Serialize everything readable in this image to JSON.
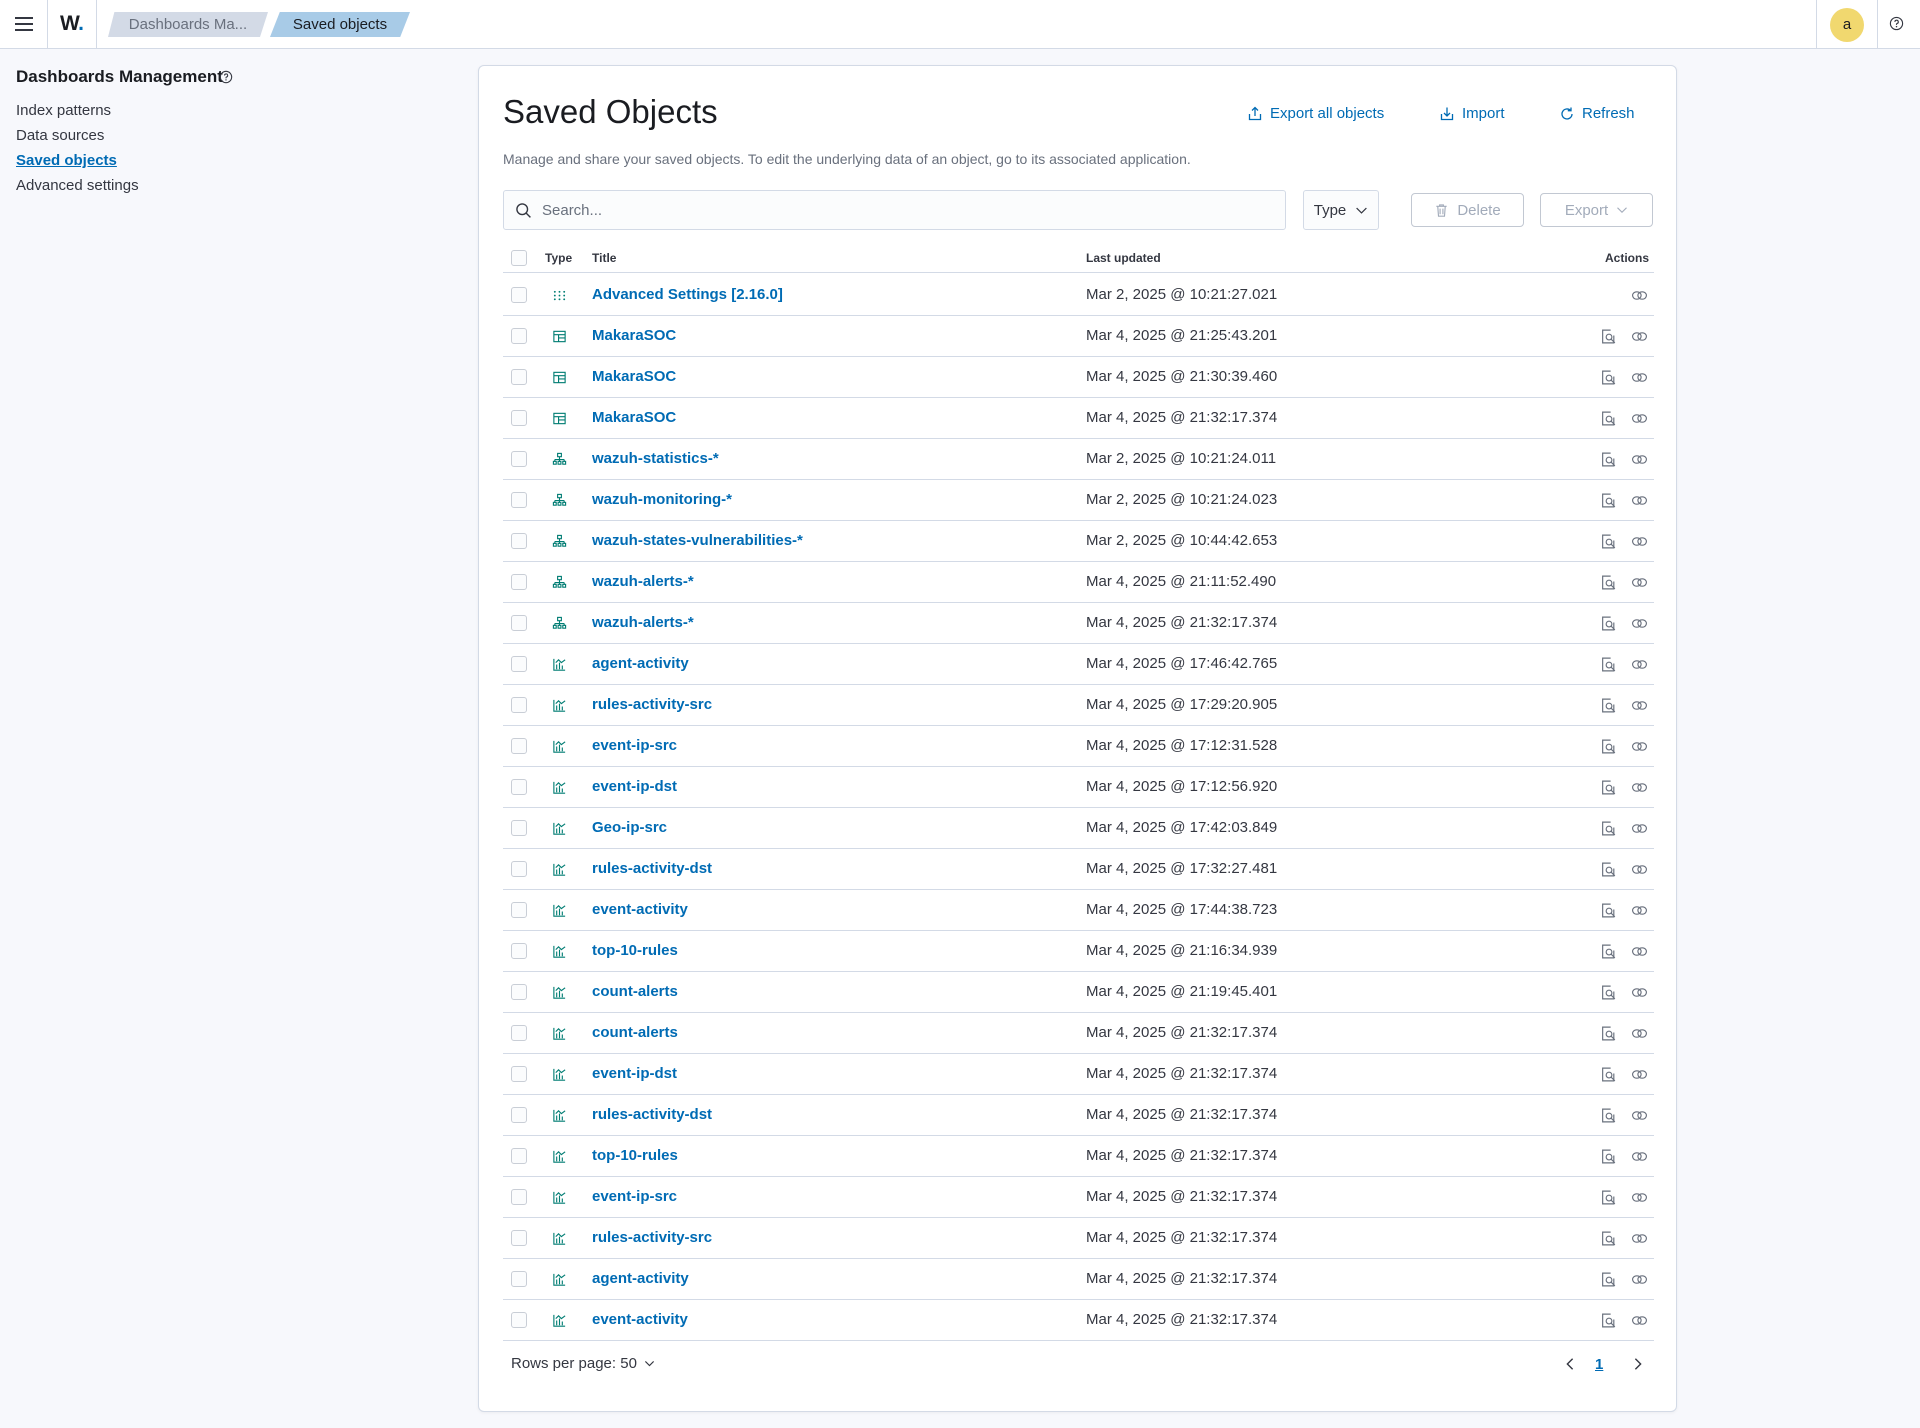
{
  "header": {
    "logo": "W",
    "logo_dot": ".",
    "breadcrumbs": [
      {
        "label": "Dashboards Ma..."
      },
      {
        "label": "Saved objects"
      }
    ],
    "avatar_initial": "a"
  },
  "sidebar": {
    "title": "Dashboards Management",
    "items": [
      {
        "label": "Index patterns",
        "active": false
      },
      {
        "label": "Data sources",
        "active": false
      },
      {
        "label": "Saved objects",
        "active": true
      },
      {
        "label": "Advanced settings",
        "active": false
      }
    ]
  },
  "main": {
    "title": "Saved Objects",
    "export_all_label": "Export all objects",
    "import_label": "Import",
    "refresh_label": "Refresh",
    "description": "Manage and share your saved objects. To edit the underlying data of an object, go to its associated application.",
    "search_placeholder": "Search...",
    "type_filter_label": "Type",
    "delete_label": "Delete",
    "export_label": "Export"
  },
  "table": {
    "columns": {
      "type": "Type",
      "title": "Title",
      "updated": "Last updated",
      "actions": "Actions"
    },
    "rows": [
      {
        "type": "config",
        "title": "Advanced Settings [2.16.0]",
        "updated": "Mar 2, 2025 @ 10:21:27.021",
        "inspect": false
      },
      {
        "type": "dashboard",
        "title": "MakaraSOC",
        "updated": "Mar 4, 2025 @ 21:25:43.201",
        "inspect": true
      },
      {
        "type": "dashboard",
        "title": "MakaraSOC",
        "updated": "Mar 4, 2025 @ 21:30:39.460",
        "inspect": true
      },
      {
        "type": "dashboard",
        "title": "MakaraSOC",
        "updated": "Mar 4, 2025 @ 21:32:17.374",
        "inspect": true
      },
      {
        "type": "index-pattern",
        "title": "wazuh-statistics-*",
        "updated": "Mar 2, 2025 @ 10:21:24.011",
        "inspect": true
      },
      {
        "type": "index-pattern",
        "title": "wazuh-monitoring-*",
        "updated": "Mar 2, 2025 @ 10:21:24.023",
        "inspect": true
      },
      {
        "type": "index-pattern",
        "title": "wazuh-states-vulnerabilities-*",
        "updated": "Mar 2, 2025 @ 10:44:42.653",
        "inspect": true
      },
      {
        "type": "index-pattern",
        "title": "wazuh-alerts-*",
        "updated": "Mar 4, 2025 @ 21:11:52.490",
        "inspect": true
      },
      {
        "type": "index-pattern",
        "title": "wazuh-alerts-*",
        "updated": "Mar 4, 2025 @ 21:32:17.374",
        "inspect": true
      },
      {
        "type": "visualization",
        "title": "agent-activity",
        "updated": "Mar 4, 2025 @ 17:46:42.765",
        "inspect": true
      },
      {
        "type": "visualization",
        "title": "rules-activity-src",
        "updated": "Mar 4, 2025 @ 17:29:20.905",
        "inspect": true
      },
      {
        "type": "visualization",
        "title": "event-ip-src",
        "updated": "Mar 4, 2025 @ 17:12:31.528",
        "inspect": true
      },
      {
        "type": "visualization",
        "title": "event-ip-dst",
        "updated": "Mar 4, 2025 @ 17:12:56.920",
        "inspect": true
      },
      {
        "type": "visualization",
        "title": "Geo-ip-src",
        "updated": "Mar 4, 2025 @ 17:42:03.849",
        "inspect": true
      },
      {
        "type": "visualization",
        "title": "rules-activity-dst",
        "updated": "Mar 4, 2025 @ 17:32:27.481",
        "inspect": true
      },
      {
        "type": "visualization",
        "title": "event-activity",
        "updated": "Mar 4, 2025 @ 17:44:38.723",
        "inspect": true
      },
      {
        "type": "visualization",
        "title": "top-10-rules",
        "updated": "Mar 4, 2025 @ 21:16:34.939",
        "inspect": true
      },
      {
        "type": "visualization",
        "title": "count-alerts",
        "updated": "Mar 4, 2025 @ 21:19:45.401",
        "inspect": true
      },
      {
        "type": "visualization",
        "title": "count-alerts",
        "updated": "Mar 4, 2025 @ 21:32:17.374",
        "inspect": true
      },
      {
        "type": "visualization",
        "title": "event-ip-dst",
        "updated": "Mar 4, 2025 @ 21:32:17.374",
        "inspect": true
      },
      {
        "type": "visualization",
        "title": "rules-activity-dst",
        "updated": "Mar 4, 2025 @ 21:32:17.374",
        "inspect": true
      },
      {
        "type": "visualization",
        "title": "top-10-rules",
        "updated": "Mar 4, 2025 @ 21:32:17.374",
        "inspect": true
      },
      {
        "type": "visualization",
        "title": "event-ip-src",
        "updated": "Mar 4, 2025 @ 21:32:17.374",
        "inspect": true
      },
      {
        "type": "visualization",
        "title": "rules-activity-src",
        "updated": "Mar 4, 2025 @ 21:32:17.374",
        "inspect": true
      },
      {
        "type": "visualization",
        "title": "agent-activity",
        "updated": "Mar 4, 2025 @ 21:32:17.374",
        "inspect": true
      },
      {
        "type": "visualization",
        "title": "event-activity",
        "updated": "Mar 4, 2025 @ 21:32:17.374",
        "inspect": true
      }
    ]
  },
  "pagination": {
    "rows_per_page_label": "Rows per page: 50",
    "current_page": "1"
  },
  "colors": {
    "link": "#006bb4",
    "icon_teal": "#017d73",
    "breadcrumb_active": "#a8cbe7",
    "avatar": "#f1d86f"
  }
}
